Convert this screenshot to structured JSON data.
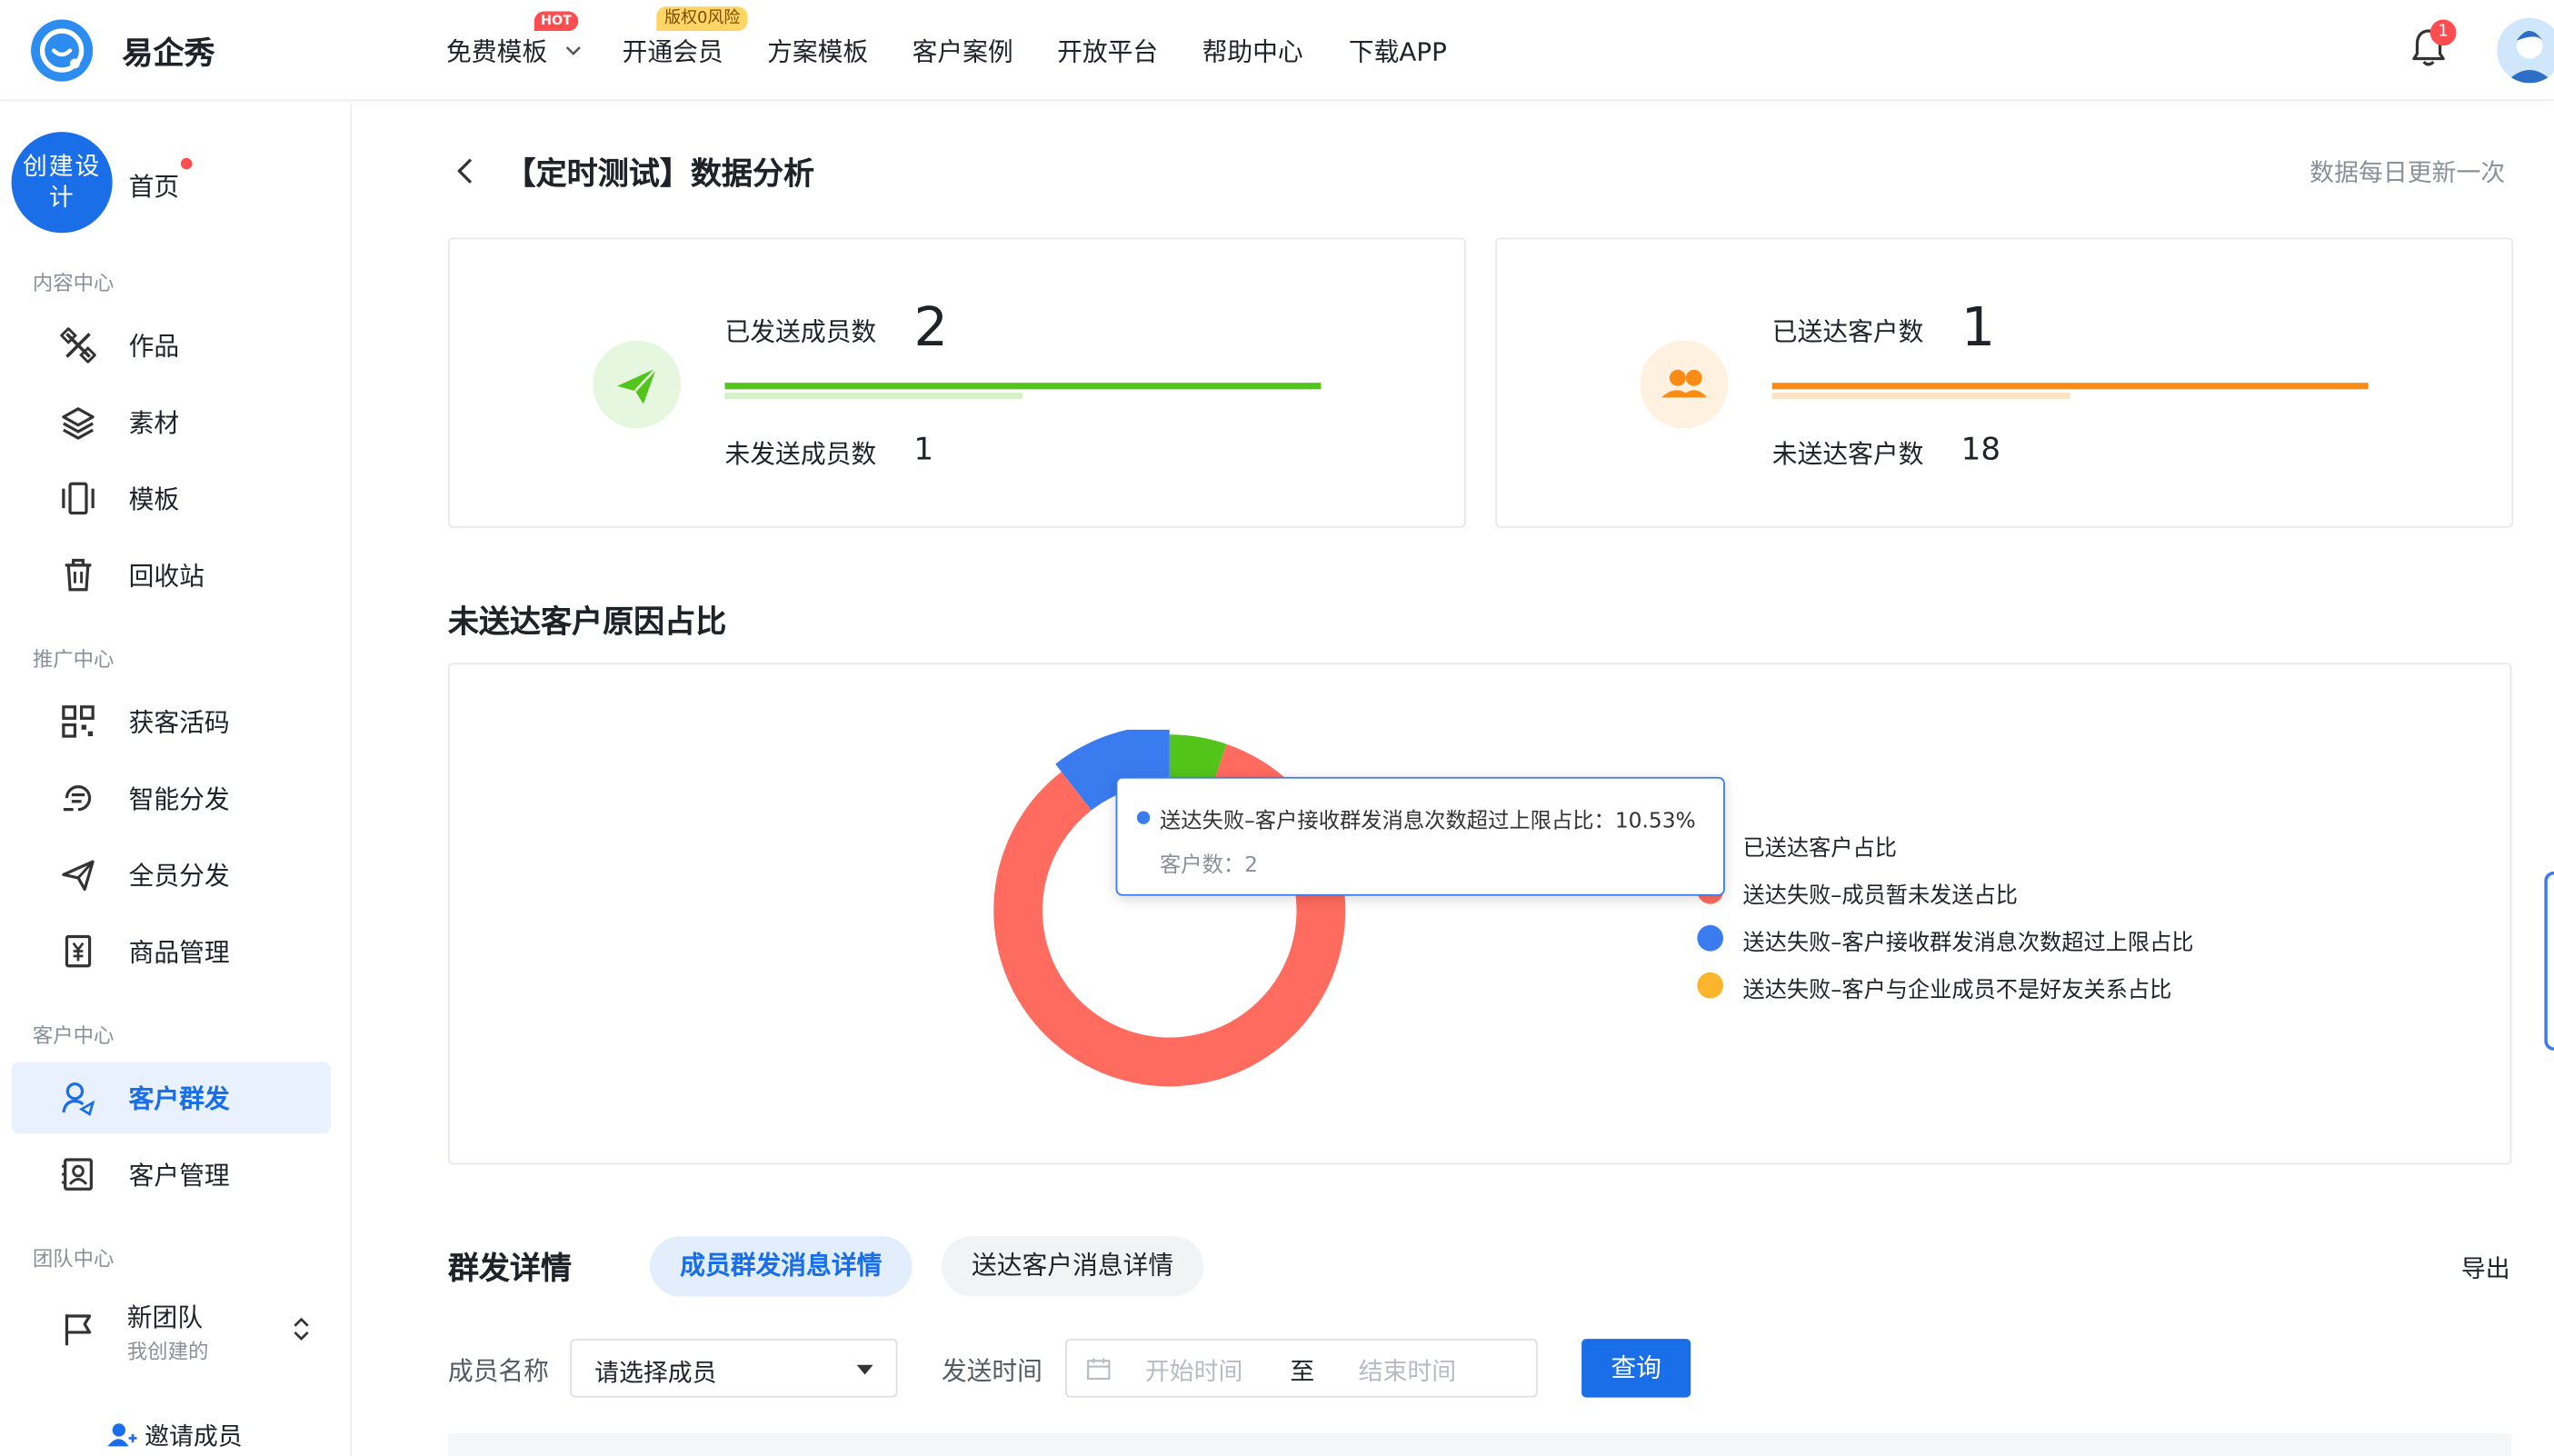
{
  "app": {
    "brand": "易企秀"
  },
  "nav": {
    "items": [
      "免费模板",
      "开通会员",
      "方案模板",
      "客户案例",
      "开放平台",
      "帮助中心",
      "下载APP"
    ],
    "hot_badge": "HOT",
    "risk_badge": "版权0风险",
    "notification_count": "1"
  },
  "sidebar": {
    "create_label": "创建设计",
    "home": "首页",
    "sections": {
      "content": "内容中心",
      "promotion": "推广中心",
      "customer": "客户中心",
      "team": "团队中心"
    },
    "content_items": [
      "作品",
      "素材",
      "模板",
      "回收站"
    ],
    "promotion_items": [
      "获客活码",
      "智能分发",
      "全员分发",
      "商品管理"
    ],
    "customer_items": [
      "客户群发",
      "客户管理"
    ],
    "active_item": "客户群发",
    "team": {
      "name": "新团队",
      "sub": "我创建的"
    },
    "invite": "邀请成员"
  },
  "page": {
    "title": "【定时测试】数据分析",
    "update_note": "数据每日更新一次"
  },
  "stats": {
    "members": {
      "sent_label": "已发送成员数",
      "sent_value": "2",
      "unsent_label": "未发送成员数",
      "unsent_value": "1",
      "color": "#52c41a"
    },
    "customers": {
      "reached_label": "已送达客户数",
      "reached_value": "1",
      "unreached_label": "未送达客户数",
      "unreached_value": "18",
      "color": "#fa8c16"
    }
  },
  "chart_section": {
    "title": "未送达客户原因占比"
  },
  "chart_data": {
    "type": "pie",
    "title": "未送达客户原因占比",
    "series": [
      {
        "name": "已送达客户占比",
        "value": 5.26,
        "color": "#52c41a"
      },
      {
        "name": "送达失败–成员暂未发送占比",
        "value": 84.21,
        "color": "#ff6b5f"
      },
      {
        "name": "送达失败–客户接收群发消息次数超过上限占比",
        "value": 10.53,
        "color": "#3a7bf0"
      },
      {
        "name": "送达失败–客户与企业成员不是好友关系占比",
        "value": 0,
        "color": "#fab52d"
      }
    ],
    "legend_position": "right"
  },
  "tooltip": {
    "line1": "送达失败–客户接收群发消息次数超过上限占比：10.53%",
    "line2": "客户数：2"
  },
  "detail": {
    "title": "群发详情",
    "tabs": [
      "成员群发消息详情",
      "送达客户消息详情"
    ],
    "export": "导出"
  },
  "filters": {
    "member_label": "成员名称",
    "member_placeholder": "请选择成员",
    "time_label": "发送时间",
    "start_placeholder": "开始时间",
    "to": "至",
    "end_placeholder": "结束时间",
    "query": "查询"
  }
}
